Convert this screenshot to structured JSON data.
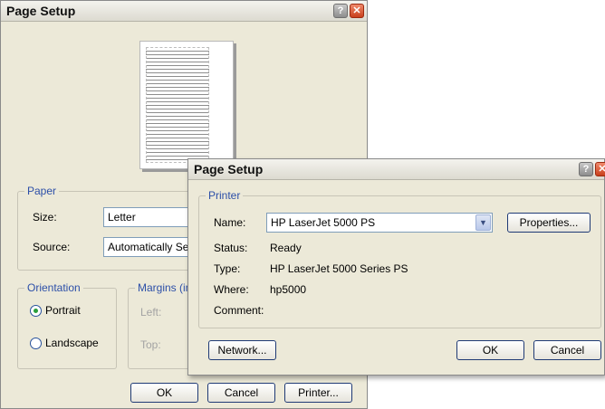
{
  "back_dialog": {
    "title": "Page Setup",
    "paper": {
      "legend": "Paper",
      "size_label": "Size:",
      "size_value": "Letter",
      "source_label": "Source:",
      "source_value": "Automatically Sel"
    },
    "orientation": {
      "legend": "Orientation",
      "portrait": "Portrait",
      "landscape": "Landscape",
      "selected": "Portrait"
    },
    "margins": {
      "legend": "Margins (in",
      "left_label": "Left:",
      "top_label": "Top:"
    },
    "buttons": {
      "ok": "OK",
      "cancel": "Cancel",
      "printer": "Printer..."
    }
  },
  "front_dialog": {
    "title": "Page Setup",
    "printer": {
      "legend": "Printer",
      "name_label": "Name:",
      "name_value": "HP LaserJet 5000 PS",
      "properties": "Properties...",
      "status_label": "Status:",
      "status_value": "Ready",
      "type_label": "Type:",
      "type_value": "HP LaserJet 5000 Series PS",
      "where_label": "Where:",
      "where_value": "hp5000",
      "comment_label": "Comment:",
      "comment_value": ""
    },
    "buttons": {
      "network": "Network...",
      "ok": "OK",
      "cancel": "Cancel"
    }
  },
  "icons": {
    "help": "help-icon",
    "close": "close-icon",
    "dropdown": "chevron-down-icon"
  },
  "colors": {
    "dialog_bg": "#ece9d8",
    "accent_blue": "#2c4fa8",
    "radio_selected": "#2a9e3c"
  }
}
